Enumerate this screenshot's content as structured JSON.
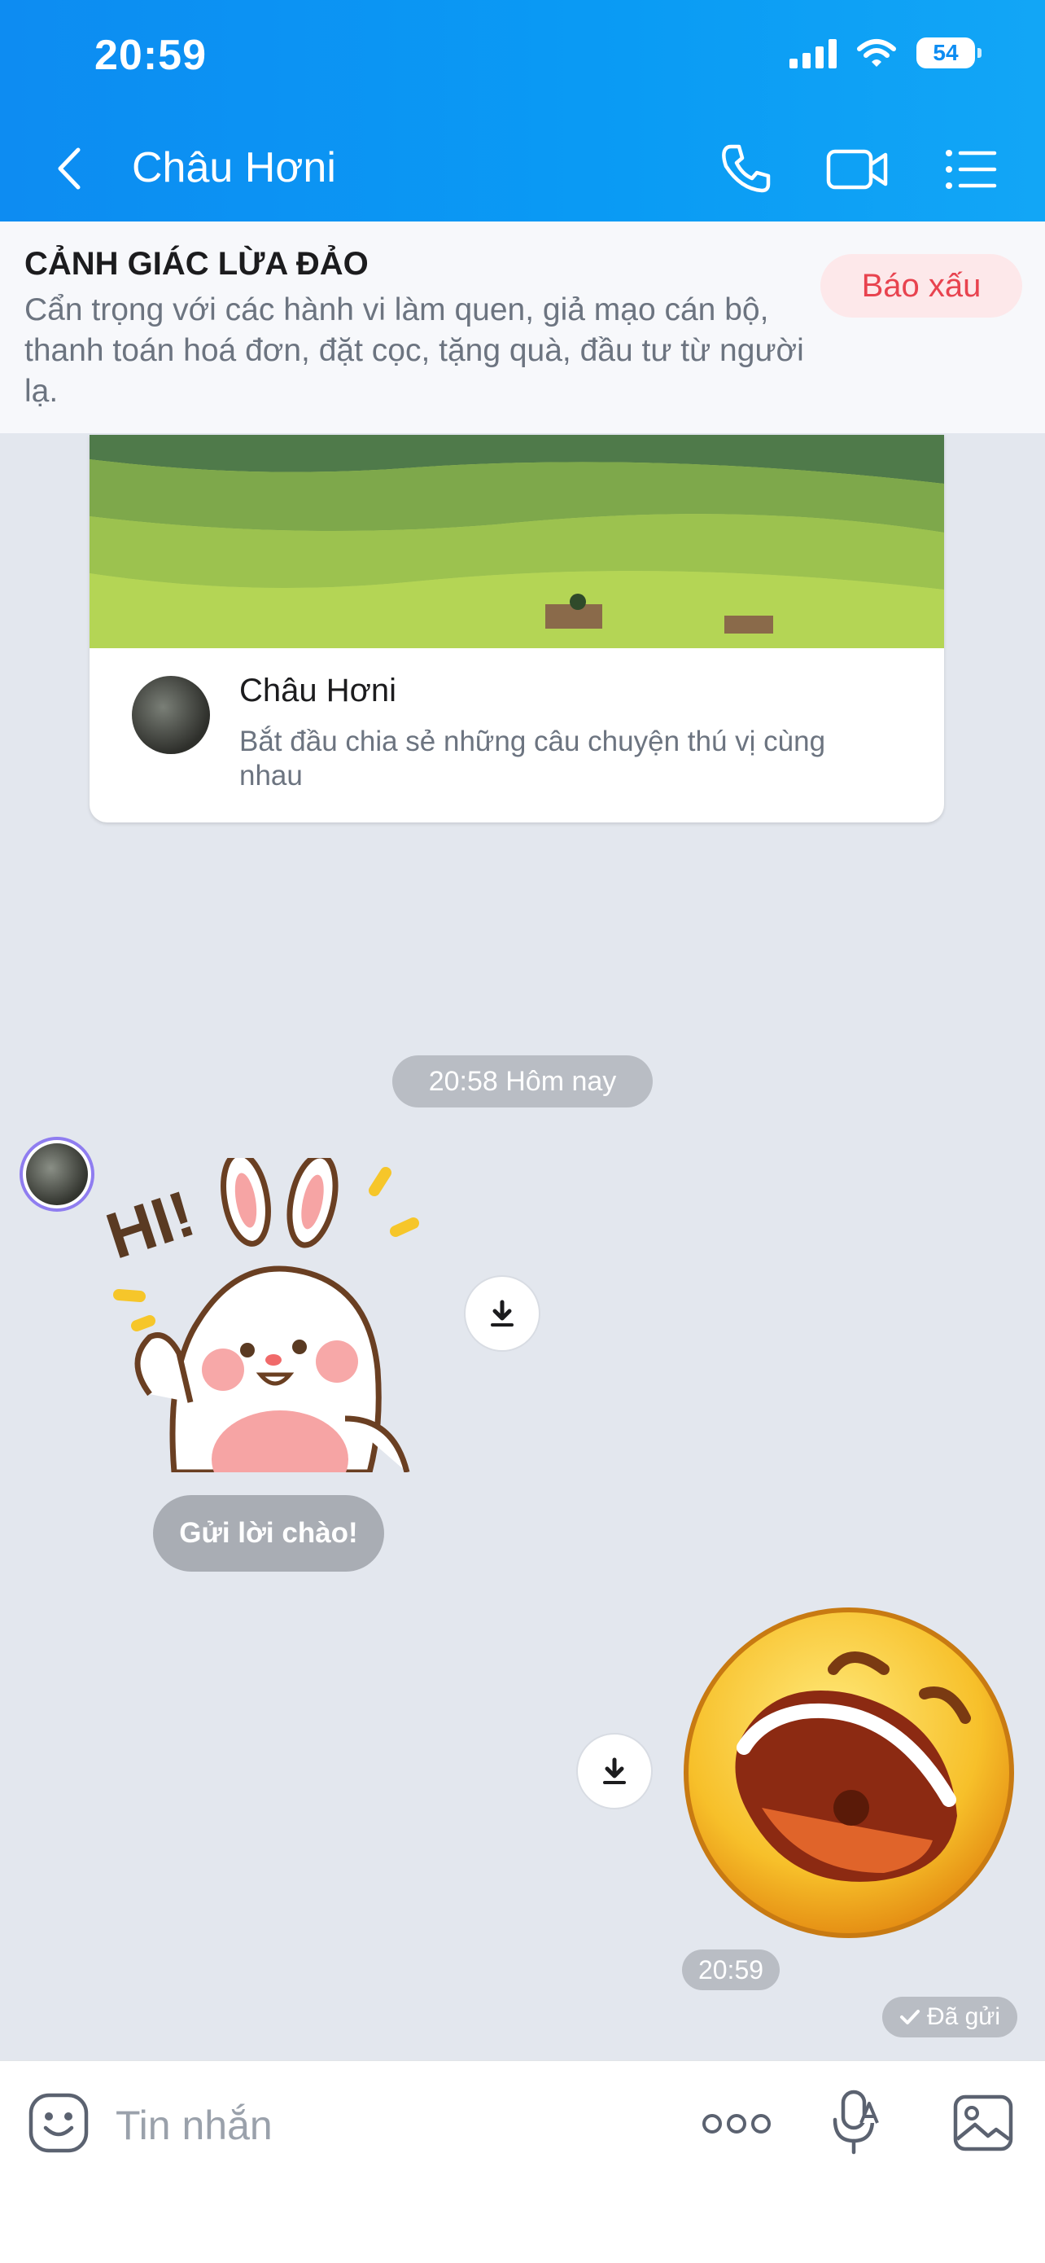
{
  "status_bar": {
    "time": "20:59",
    "battery": "54"
  },
  "header": {
    "title": "Châu Hơni"
  },
  "warning": {
    "title": "CẢNH GIÁC LỪA ĐẢO",
    "text": "Cẩn trọng với các hành vi làm quen, giả mạo cán bộ, thanh toán hoá đơn, đặt cọc, tặng quà, đầu tư từ người lạ.",
    "report_label": "Báo xấu"
  },
  "profile_card": {
    "name": "Châu Hơni",
    "description": "Bắt đầu chia sẻ những câu chuyện thú vị cùng nhau"
  },
  "chat": {
    "time_divider": "20:58 Hôm nay",
    "incoming": {
      "sticker_text": "HI!",
      "greet_label": "Gửi lời chào!"
    },
    "outgoing": {
      "time": "20:59",
      "status": "Đã gửi"
    }
  },
  "input_bar": {
    "placeholder": "Tin nhắn"
  },
  "colors": {
    "header_blue": "#0d8cf2",
    "report_red": "#e8434f",
    "chat_bg": "#e3e7ee"
  }
}
